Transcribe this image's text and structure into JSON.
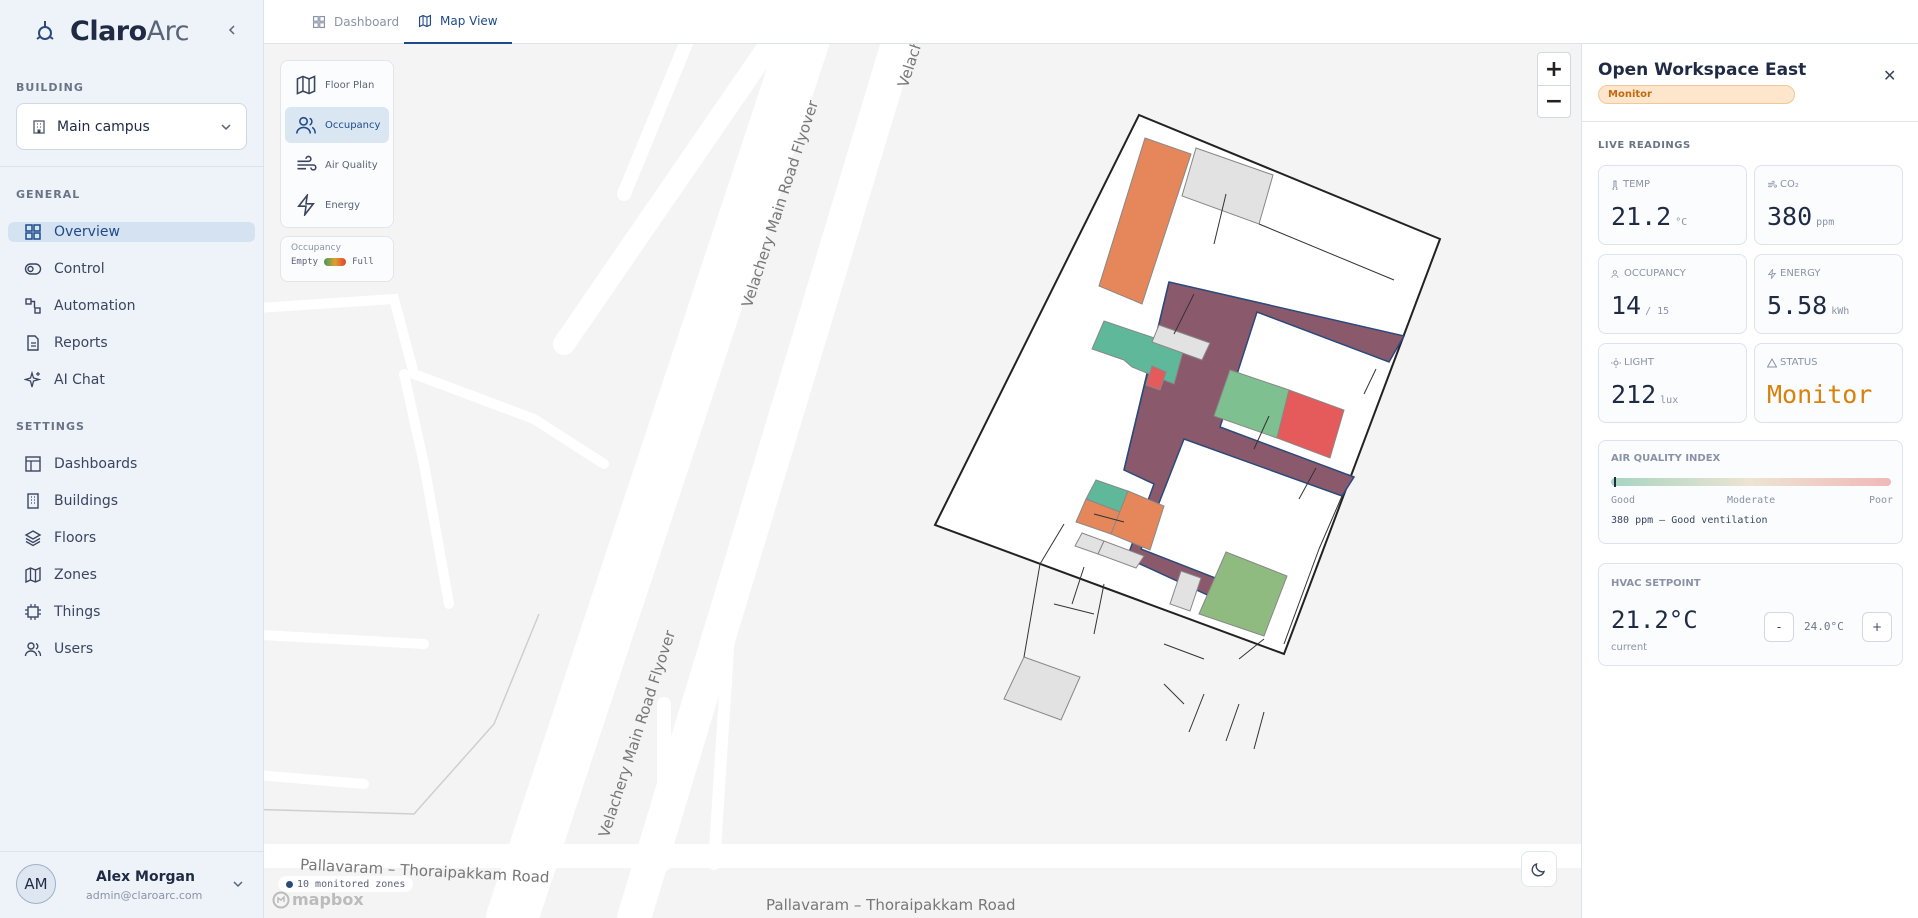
{
  "brand": {
    "name_bold": "Claro",
    "name_light": "Arc"
  },
  "sidebar": {
    "building_section": "BUILDING",
    "building_value": "Main campus",
    "general_section": "GENERAL",
    "general_items": [
      {
        "label": "Overview",
        "icon": "grid-icon",
        "active": true
      },
      {
        "label": "Control",
        "icon": "toggle-icon"
      },
      {
        "label": "Automation",
        "icon": "workflow-icon"
      },
      {
        "label": "Reports",
        "icon": "report-icon"
      },
      {
        "label": "AI Chat",
        "icon": "sparkle-icon"
      }
    ],
    "settings_section": "SETTINGS",
    "settings_items": [
      {
        "label": "Dashboards",
        "icon": "layout-icon"
      },
      {
        "label": "Buildings",
        "icon": "building-icon"
      },
      {
        "label": "Floors",
        "icon": "layers-icon"
      },
      {
        "label": "Zones",
        "icon": "map-icon"
      },
      {
        "label": "Things",
        "icon": "chip-icon"
      },
      {
        "label": "Users",
        "icon": "users-icon"
      }
    ],
    "user": {
      "initials": "AM",
      "name": "Alex Morgan",
      "email": "admin@claroarc.com"
    }
  },
  "tabs": [
    {
      "label": "Dashboard",
      "active": false
    },
    {
      "label": "Map View",
      "active": true
    }
  ],
  "map": {
    "layers": [
      {
        "label": "Floor Plan",
        "icon": "map-icon"
      },
      {
        "label": "Occupancy",
        "icon": "users-icon",
        "active": true
      },
      {
        "label": "Air Quality",
        "icon": "wind-icon"
      },
      {
        "label": "Energy",
        "icon": "bolt-icon"
      }
    ],
    "legend": {
      "title": "Occupancy",
      "min": "Empty",
      "max": "Full"
    },
    "zones_chip": "10 monitored zones",
    "mapbox": "mapbox",
    "roads": [
      "Velachery Main Road Flyover",
      "Velachery Main Road Flyover",
      "Pallavaram – Thoraipakkam Road",
      "Pallavaram – Thoraipakkam Road",
      "Velach"
    ],
    "zoom_in": "+",
    "zoom_out": "−"
  },
  "panel": {
    "title": "Open Workspace East",
    "badge": "Monitor",
    "close": "✕",
    "live_label": "LIVE READINGS",
    "cards": [
      {
        "label": "TEMP",
        "value": "21.2",
        "unit": "°C"
      },
      {
        "label": "CO₂",
        "value": "380",
        "unit": "ppm"
      },
      {
        "label": "OCCUPANCY",
        "value": "14",
        "unit": "/ 15"
      },
      {
        "label": "ENERGY",
        "value": "5.58",
        "unit": "kWh"
      },
      {
        "label": "LIGHT",
        "value": "212",
        "unit": "lux"
      },
      {
        "label": "STATUS",
        "value": "Monitor",
        "unit": ""
      }
    ],
    "aqi": {
      "title": "AIR QUALITY INDEX",
      "scale": [
        "Good",
        "Moderate",
        "Poor"
      ],
      "note": "380 ppm — Good ventilation",
      "level": 0.01
    },
    "hvac": {
      "title": "HVAC SETPOINT",
      "current": "21.2°C",
      "current_label": "current",
      "target": "24.0°C",
      "minus": "-",
      "plus": "+"
    }
  }
}
